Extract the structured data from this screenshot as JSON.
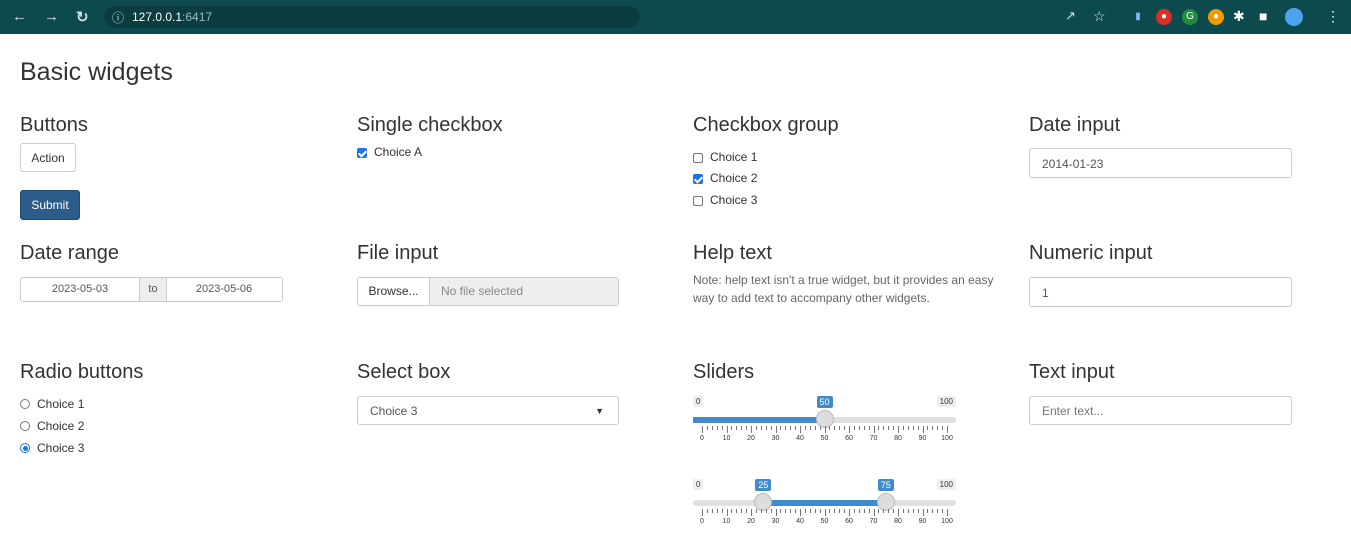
{
  "browser": {
    "url_host": "127.0.0.1",
    "url_port": ":6417"
  },
  "page_title": "Basic widgets",
  "buttons": {
    "title": "Buttons",
    "action_label": "Action",
    "submit_label": "Submit"
  },
  "single_checkbox": {
    "title": "Single checkbox",
    "label": "Choice A",
    "checked": true
  },
  "checkbox_group": {
    "title": "Checkbox group",
    "items": [
      {
        "label": "Choice 1",
        "checked": false
      },
      {
        "label": "Choice 2",
        "checked": true
      },
      {
        "label": "Choice 3",
        "checked": false
      }
    ]
  },
  "date_input": {
    "title": "Date input",
    "value": "2014-01-23"
  },
  "date_range": {
    "title": "Date range",
    "start": "2023-05-03",
    "separator": "to",
    "end": "2023-05-06"
  },
  "file_input": {
    "title": "File input",
    "browse_label": "Browse...",
    "placeholder": "No file selected"
  },
  "help_text": {
    "title": "Help text",
    "line1": "Note: help text isn't a true widget, but it provides an easy",
    "line2": "way to add text to accompany other widgets."
  },
  "numeric_input": {
    "title": "Numeric input",
    "value": "1"
  },
  "radio_buttons": {
    "title": "Radio buttons",
    "items": [
      {
        "label": "Choice 1",
        "selected": false
      },
      {
        "label": "Choice 2",
        "selected": false
      },
      {
        "label": "Choice 3",
        "selected": true
      }
    ]
  },
  "select_box": {
    "title": "Select box",
    "value": "Choice 3"
  },
  "sliders": {
    "title": "Sliders",
    "min_label": "0",
    "max_label": "100",
    "single_value": "50",
    "range_low": "25",
    "range_high": "75",
    "tick_labels": [
      "0",
      "10",
      "20",
      "30",
      "40",
      "50",
      "60",
      "70",
      "80",
      "90",
      "100"
    ]
  },
  "text_input": {
    "title": "Text input",
    "placeholder": "Enter text..."
  },
  "colors": {
    "chrome": "#0c4a4e",
    "primary": "#2c5d8a",
    "slider": "#428bca"
  }
}
